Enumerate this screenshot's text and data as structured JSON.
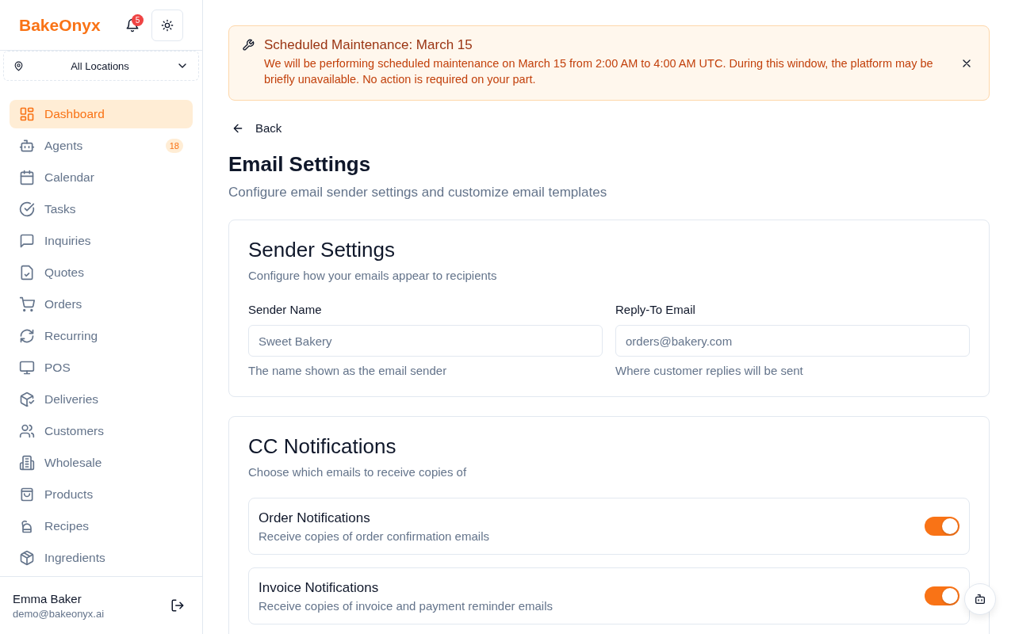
{
  "sidebar": {
    "logo": "BakeOnyx",
    "notifications": "5",
    "location": "All Locations",
    "items": [
      {
        "label": "Dashboard",
        "selected": true
      },
      {
        "label": "Agents",
        "selected": false,
        "badge": "18"
      },
      {
        "label": "Calendar",
        "selected": false
      },
      {
        "label": "Tasks",
        "selected": false
      },
      {
        "label": "Inquiries",
        "selected": false
      },
      {
        "label": "Quotes",
        "selected": false
      },
      {
        "label": "Orders",
        "selected": false
      },
      {
        "label": "Recurring",
        "selected": false
      },
      {
        "label": "POS",
        "selected": false
      },
      {
        "label": "Deliveries",
        "selected": false
      },
      {
        "label": "Customers",
        "selected": false
      },
      {
        "label": "Wholesale",
        "selected": false
      },
      {
        "label": "Products",
        "selected": false
      },
      {
        "label": "Recipes",
        "selected": false
      },
      {
        "label": "Ingredients",
        "selected": false
      }
    ],
    "user": {
      "name": "Emma Baker",
      "email": "demo@bakeonyx.ai"
    }
  },
  "alert": {
    "title": "Scheduled Maintenance: March 15",
    "message": "We will be performing scheduled maintenance on March 15 from 2:00 AM to 4:00 AM UTC. During this window, the platform may be briefly unavailable. No action is required on your part."
  },
  "back": "Back",
  "page": {
    "title": "Email Settings",
    "subtitle": "Configure email sender settings and customize email templates"
  },
  "sender": {
    "title": "Sender Settings",
    "subtitle": "Configure how your emails appear to recipients",
    "fields": [
      {
        "label": "Sender Name",
        "placeholder": "Sweet Bakery",
        "hint": "The name shown as the email sender"
      },
      {
        "label": "Reply-To Email",
        "placeholder": "orders@bakery.com",
        "hint": "Where customer replies will be sent"
      }
    ]
  },
  "cc": {
    "title": "CC Notifications",
    "subtitle": "Choose which emails to receive copies of",
    "options": [
      {
        "title": "Order Notifications",
        "description": "Receive copies of order confirmation emails",
        "on": true
      },
      {
        "title": "Invoice Notifications",
        "description": "Receive copies of invoice and payment reminder emails",
        "on": true
      }
    ]
  }
}
